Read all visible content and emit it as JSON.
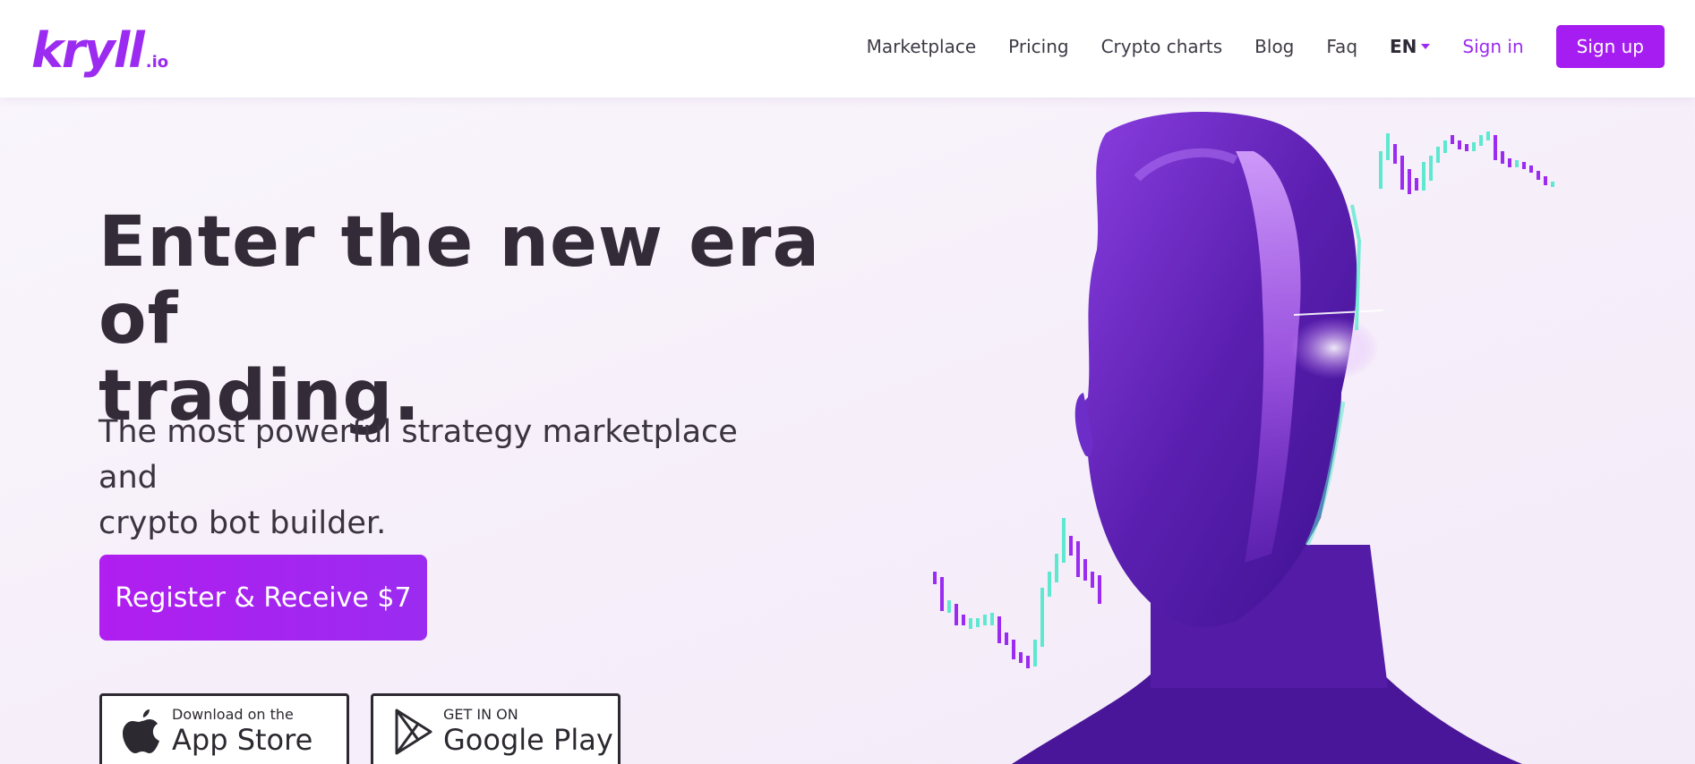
{
  "brand": {
    "logo_main": "kryll",
    "logo_tld": ".io",
    "accent_color": "#9b2bf0",
    "teal_color": "#5fe8d0"
  },
  "nav": {
    "marketplace": "Marketplace",
    "pricing": "Pricing",
    "crypto_charts": "Crypto charts",
    "blog": "Blog",
    "faq": "Faq",
    "language": "EN",
    "sign_in": "Sign in",
    "sign_up": "Sign up"
  },
  "hero": {
    "title_line1": "Enter the new era of",
    "title_line2": "trading.",
    "subtitle_line1": "The most powerful strategy marketplace and",
    "subtitle_line2": "crypto bot builder.",
    "register_button": "Register & Receive $7"
  },
  "stores": {
    "apple_small": "Download on the",
    "apple_big": "App Store",
    "google_small": "GET IN ON",
    "google_big": "Google Play"
  },
  "icons": {
    "apple": "apple-icon",
    "google_play": "google-play-icon",
    "language_caret": "chevron-down-icon"
  }
}
